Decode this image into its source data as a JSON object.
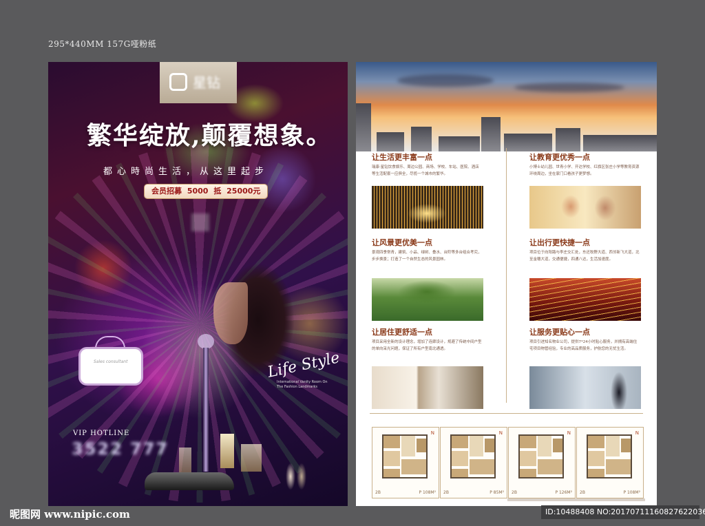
{
  "spec_label": "295*440MM   157G哑粉纸",
  "poster": {
    "logo_text": "星钻",
    "headline": "繁华绽放,颠覆想象。",
    "subline": "都心時尚生活，从这里起步",
    "member_pre": "会员招募",
    "member_amount1": "5000",
    "member_mid": "抵",
    "member_amount2": "25000元",
    "frame_note": "Sales consultant",
    "lifestyle": "Life Style",
    "lifestyle_sub": "International Vanity Room On The Fashion Landmarks",
    "hotline_label": "VIP HOTLINE",
    "phone": "3522 777"
  },
  "flyer": {
    "sections": [
      {
        "title": "让生活更丰富一点",
        "body": "瑞康·星钻饮食娱乐、周边公园、商场、学校、车站、医院、酒店等生活配套一应俱全，尽揽一个城市的繁华。"
      },
      {
        "title": "让教育更优秀一点",
        "body": "小博士幼儿园、世青小学、开达学校、红旗区张庄小学等教育资源环绕周边，坐在家门口看孩子更梦想。"
      },
      {
        "title": "让风景更优美一点",
        "body": "景观四季常青，建筑、小品、绿树、叠水、台阶等多台组合考究，步步换景；打造了一个自然生态的风景园林。"
      },
      {
        "title": "让出行更快捷一点",
        "body": "项目位于向阳路与李庄交汇处，东还牧野大道、西邻新飞大道，北至金穗大道，交通便捷，四通八达，生活加速度。"
      },
      {
        "title": "让居住更舒适一点",
        "body": "项目采用全新的设计理念，增加了连廊设计，规避了传统中间户型的单向采光问题，保证了所有户型南北通透。"
      },
      {
        "title": "让服务更贴心一点",
        "body": "项目引进知名物业公司，提供7*24小时贴心服务，并拥有高端住宅项目物管经验，专业的高品质服务，护航您的无忧生活。"
      }
    ],
    "plans": [
      {
        "label": "2B",
        "area": "P 108M²"
      },
      {
        "label": "2B",
        "area": "P 85M²"
      },
      {
        "label": "2B",
        "area": "P 126M²"
      },
      {
        "label": "2B",
        "area": "P 108M²"
      }
    ],
    "compass": "N"
  },
  "watermark": {
    "site_cn": "昵图网",
    "site_url": "www.nipic.com",
    "id_text": "ID:10488408 NO:20170711160827622036"
  }
}
